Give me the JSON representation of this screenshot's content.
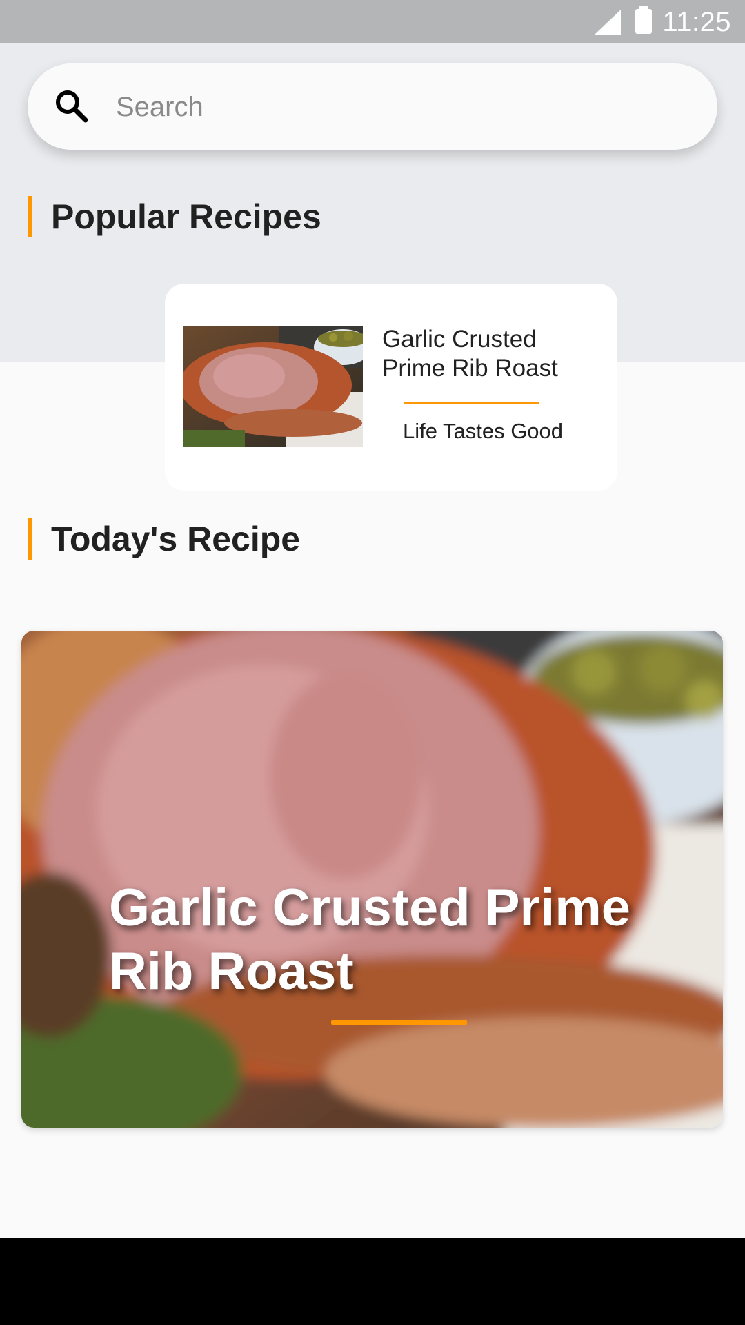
{
  "status_bar": {
    "time": "11:25"
  },
  "search": {
    "placeholder": "Search"
  },
  "sections": {
    "popular": {
      "title": "Popular Recipes"
    },
    "today": {
      "title": "Today's Recipe"
    }
  },
  "popular_card": {
    "title": "Garlic Crusted Prime Rib Roast",
    "subtitle": "Life Tastes Good"
  },
  "today_card": {
    "title": "Garlic Crusted Prime Rib Roast"
  },
  "colors": {
    "accent": "#ff9800",
    "background": "#fafafa",
    "header_band": "#e9ebee",
    "status_bar": "#b4b5b7"
  }
}
